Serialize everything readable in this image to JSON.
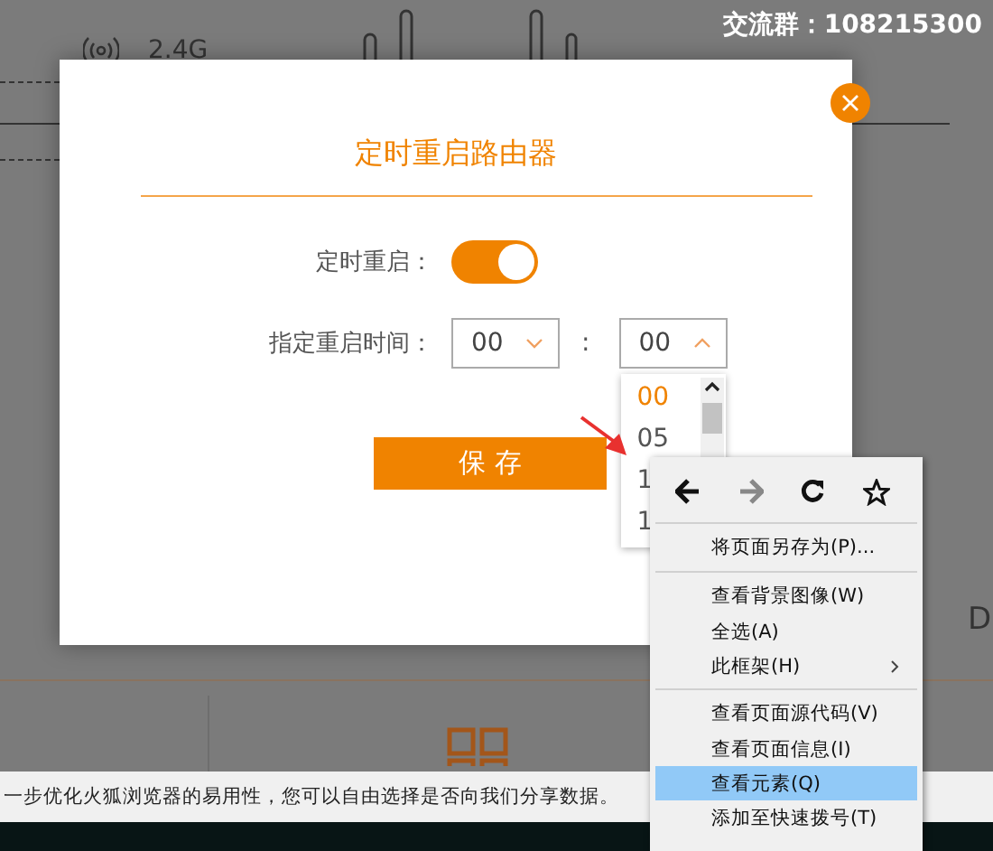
{
  "background": {
    "band_label": "2.4G",
    "group_label": "交流群：108215300",
    "edge_text": "D",
    "notice": "一步优化火狐浏览器的易用性，您可以自由选择是否向我们分享数据。"
  },
  "dialog": {
    "title": "定时重启路由器",
    "fields": [
      {
        "kind": "toggle",
        "label": "定时重启：",
        "on": true
      },
      {
        "kind": "time",
        "label": "指定重启时间：",
        "hour": {
          "value": "00",
          "expanded": false
        },
        "separator": ":",
        "minute": {
          "value": "00",
          "expanded": true
        }
      }
    ],
    "save_button": "保 存"
  },
  "minute_options": [
    {
      "label": "00",
      "selected": true
    },
    {
      "label": "05",
      "selected": false
    },
    {
      "label": "1",
      "selected": false
    },
    {
      "label": "1",
      "selected": false
    }
  ],
  "context_menu": {
    "items": [
      {
        "label": "将页面另存为(P)...",
        "separator_before": true,
        "submenu": false,
        "highlighted": false
      },
      {
        "label": "查看背景图像(W)",
        "separator_before": true,
        "submenu": false,
        "highlighted": false
      },
      {
        "label": "全选(A)",
        "separator_before": false,
        "submenu": false,
        "highlighted": false
      },
      {
        "label": "此框架(H)",
        "separator_before": false,
        "submenu": true,
        "highlighted": false
      },
      {
        "label": "查看页面源代码(V)",
        "separator_before": true,
        "submenu": false,
        "highlighted": false
      },
      {
        "label": "查看页面信息(I)",
        "separator_before": false,
        "submenu": false,
        "highlighted": false
      },
      {
        "label": "查看元素(Q)",
        "separator_before": false,
        "submenu": false,
        "highlighted": true
      },
      {
        "label": "添加至快速拨号(T)",
        "separator_before": false,
        "submenu": false,
        "highlighted": false
      }
    ]
  }
}
